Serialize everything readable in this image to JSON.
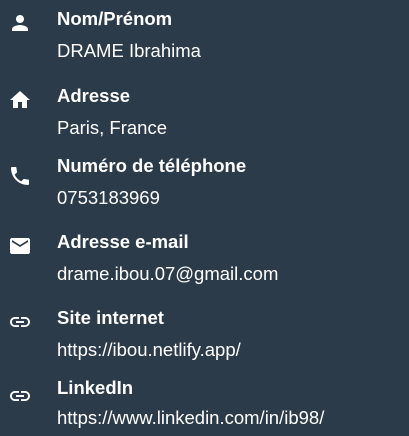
{
  "contacts": [
    {
      "icon": "person-icon",
      "label": "Nom/Prénom",
      "value": "DRAME Ibrahima"
    },
    {
      "icon": "home-icon",
      "label": "Adresse",
      "value": "Paris, France"
    },
    {
      "icon": "phone-icon",
      "label": "Numéro de téléphone",
      "value": "0753183969"
    },
    {
      "icon": "email-icon",
      "label": "Adresse e-mail",
      "value": "drame.ibou.07@gmail.com"
    },
    {
      "icon": "link-icon",
      "label": "Site internet",
      "value": "https://ibou.netlify.app/"
    },
    {
      "icon": "link-icon",
      "label": "LinkedIn",
      "value": "https://www.linkedin.com/in/ib98/"
    }
  ],
  "colors": {
    "background": "#2c3b49",
    "text": "#ffffff"
  }
}
